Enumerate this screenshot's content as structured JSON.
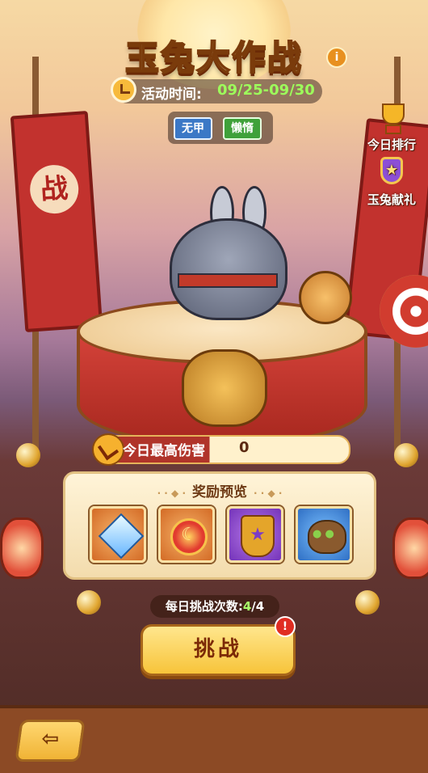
{
  "header": {
    "title": "玉兔大作战",
    "info_icon": "info-icon",
    "time_label": "活动时间:",
    "time_range": "09/25-09/30",
    "tags": [
      "无甲",
      "懒惰"
    ]
  },
  "side_menu": {
    "items": [
      {
        "label": "今日排行",
        "icon": "trophy-icon"
      },
      {
        "label": "玉兔献礼",
        "icon": "star-badge-icon"
      }
    ]
  },
  "banner_char": "战",
  "damage": {
    "label": "今日最高伤害",
    "value": "0"
  },
  "rewards": {
    "title": "奖励预览",
    "items": [
      {
        "icon": "diamond-icon",
        "rarity": "orange"
      },
      {
        "icon": "moon-coin-icon",
        "rarity": "orange"
      },
      {
        "icon": "star-emblem-icon",
        "rarity": "purple"
      },
      {
        "icon": "seed-bag-icon",
        "rarity": "blue"
      }
    ]
  },
  "attempts": {
    "label": "每日挑战次数:",
    "current": "4",
    "separator": "/",
    "max": "4"
  },
  "challenge_button": {
    "label": "挑战",
    "alert": "!"
  },
  "back_button": {
    "icon": "back-arrow-icon",
    "glyph": "⇦"
  },
  "colors": {
    "title_fill": "#fff2c0",
    "time_value": "#9dff5b",
    "attempts_value": "#a8ff6a",
    "button_gold": "#f7c43a"
  }
}
